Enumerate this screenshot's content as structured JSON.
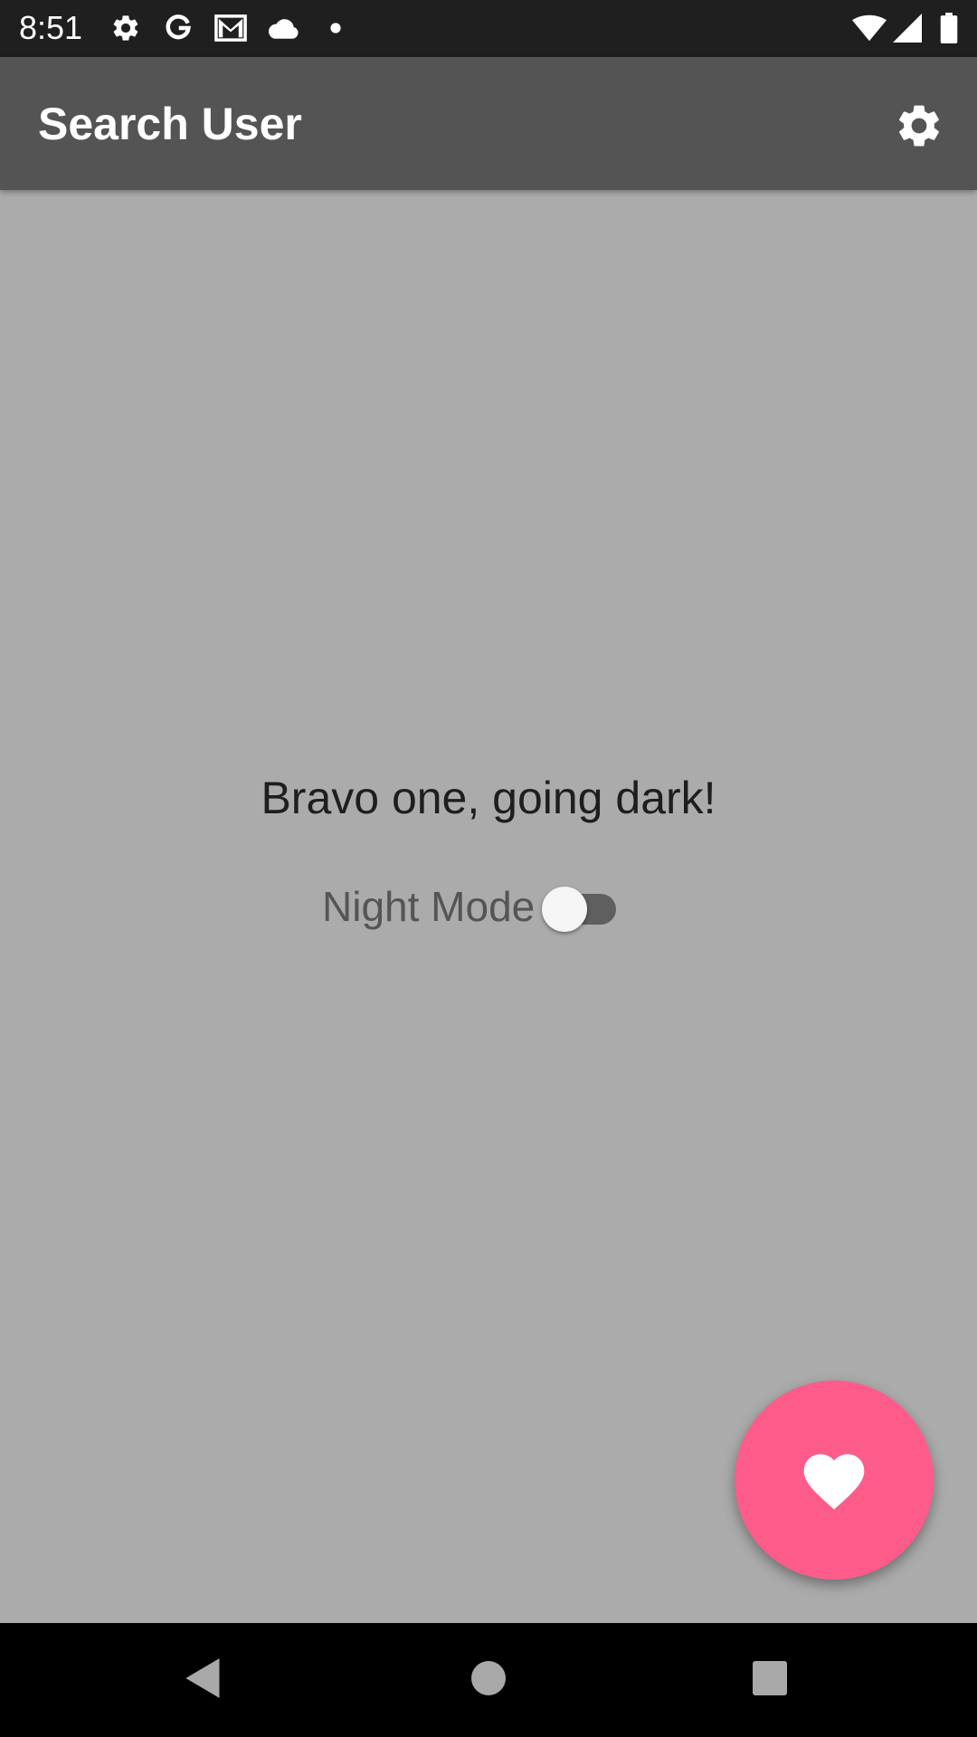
{
  "status_bar": {
    "time": "8:51",
    "icons": [
      "gear-icon",
      "google-icon",
      "gmail-icon",
      "cloud-icon",
      "dot-icon",
      "wifi-icon",
      "signal-icon",
      "battery-icon"
    ]
  },
  "app_bar": {
    "title": "Search User",
    "action_icon": "gear-icon"
  },
  "main": {
    "headline": "Bravo one, going dark!",
    "night_mode": {
      "label": "Night Mode",
      "checked": false
    }
  },
  "fab": {
    "icon": "heart-icon",
    "color": "#fd5c8a"
  },
  "nav_bar": {
    "buttons": [
      "back-icon",
      "home-icon",
      "recents-icon"
    ]
  },
  "colors": {
    "background": "#ababab",
    "app_bar": "#545454",
    "status_bar": "#1f1f1f",
    "accent": "#fd5c8a"
  }
}
